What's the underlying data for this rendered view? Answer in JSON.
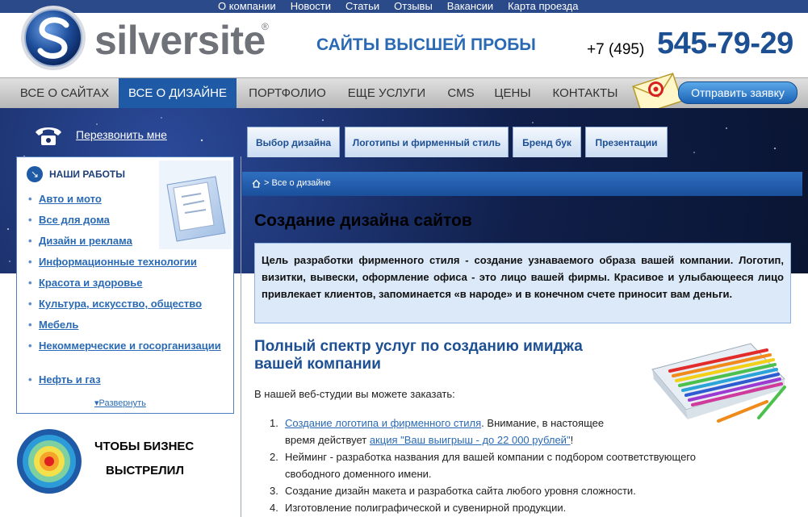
{
  "top_links": [
    "О компании",
    "Новости",
    "Статьи",
    "Отзывы",
    "Вакансии",
    "Карта проезда"
  ],
  "header": {
    "brand": "silversite",
    "reg_mark": "®",
    "slogan": "САЙТЫ ВЫСШЕЙ ПРОБЫ",
    "phone_prefix": "+7 (495)",
    "phone_main": "545-79-29"
  },
  "nav": [
    {
      "label": "ВСЕ О САЙТАХ",
      "active": false
    },
    {
      "label": "ВСЕ О ДИЗАЙНЕ",
      "active": true
    },
    {
      "label": "ПОРТФОЛИО",
      "active": false
    },
    {
      "label": "ЕЩЕ УСЛУГИ",
      "active": false
    },
    {
      "label": "CMS",
      "active": false
    },
    {
      "label": "ЦЕНЫ",
      "active": false
    },
    {
      "label": "КОНТАКТЫ",
      "active": false
    }
  ],
  "request_button": "Отправить заявку",
  "callback": "Перезвонить мне",
  "subtabs": [
    "Выбор дизайна",
    "Логотипы и фирменный стиль",
    "Бренд бук",
    "Презентации"
  ],
  "our_works": {
    "title": "НАШИ РАБОТЫ",
    "items": [
      "Авто и мото",
      "Все для дома",
      "Дизайн и реклама",
      "Информационные технологии",
      "Красота и здоровье",
      "Культура, искусство, общество",
      "Мебель",
      "Некоммерческие и госорганизации",
      "Нефть и газ"
    ],
    "expand": "Развернуть"
  },
  "promo": {
    "line1": "ЧТОБЫ БИЗНЕС",
    "line2": "ВЫСТРЕЛИЛ"
  },
  "breadcrumb": "> Все о дизайне",
  "main": {
    "title": "Создание дизайна сайтов",
    "infobox": "Цель разработки фирменного стиля - создание узнаваемого образа вашей компании. Логотип, визитки, вывески, оформление офиса - это лицо вашей фирмы. Красивое и улыбающееся лицо привлекает клиентов, запоминается «в народе» и в конечном счете приносит вам деньги.",
    "subtitle": "Полный спектр услуг по созданию имиджа вашей компании",
    "intro": "В нашей веб-студии вы можете заказать:",
    "services": {
      "s1_link": "Создание логотипа и фирменного стиля",
      "s1_text_a": ".  Внимание, в настоящее",
      "s1_text_b": "время действует ",
      "s1_link2": "акция \"Ваш выигрыш - до 22 000 рублей\"",
      "s1_text_c": "!",
      "s2": "Нейминг - разработка названия для вашей компании с подбором соответствующего свободного доменного имени.",
      "s3": "Создание дизайн макета и разработка сайта любого уровня сложности.",
      "s4": "Изготовление полиграфической и сувенирной продукции."
    }
  }
}
